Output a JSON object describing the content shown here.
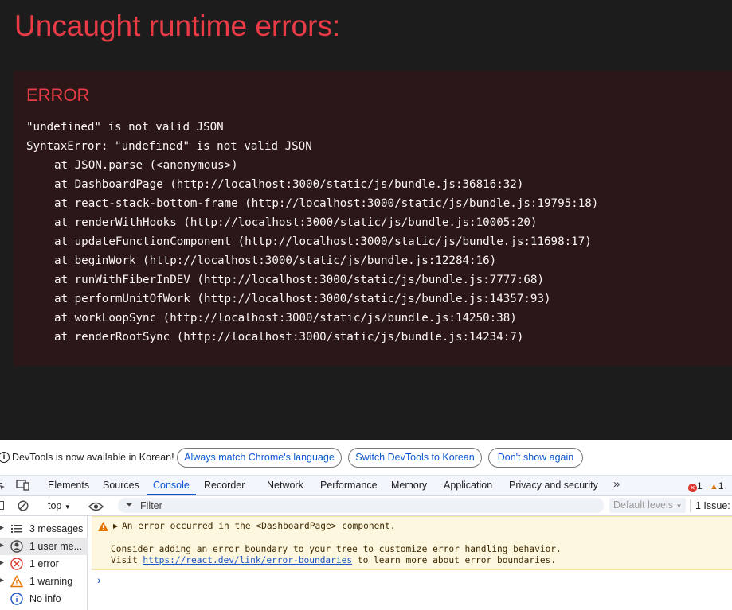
{
  "overlay": {
    "title": "Uncaught runtime errors:",
    "error_label": "ERROR",
    "message_lines": [
      "\"undefined\" is not valid JSON",
      "SyntaxError: \"undefined\" is not valid JSON"
    ],
    "stack": [
      "at JSON.parse (<anonymous>)",
      "at DashboardPage (http://localhost:3000/static/js/bundle.js:36816:32)",
      "at react-stack-bottom-frame (http://localhost:3000/static/js/bundle.js:19795:18)",
      "at renderWithHooks (http://localhost:3000/static/js/bundle.js:10005:20)",
      "at updateFunctionComponent (http://localhost:3000/static/js/bundle.js:11698:17)",
      "at beginWork (http://localhost:3000/static/js/bundle.js:12284:16)",
      "at runWithFiberInDEV (http://localhost:3000/static/js/bundle.js:7777:68)",
      "at performUnitOfWork (http://localhost:3000/static/js/bundle.js:14357:93)",
      "at workLoopSync (http://localhost:3000/static/js/bundle.js:14250:38)",
      "at renderRootSync (http://localhost:3000/static/js/bundle.js:14234:7)"
    ],
    "colors": {
      "title": "#e83b46",
      "box_bg": "#2b1718",
      "text": "#fbf5f4"
    }
  },
  "devtools": {
    "infobar": {
      "icon": "info-icon",
      "text": "DevTools is now available in Korean!",
      "buttons": [
        "Always match Chrome's language",
        "Switch DevTools to Korean",
        "Don't show again"
      ]
    },
    "tabs": [
      "Elements",
      "Sources",
      "Console",
      "Recorder",
      "Network",
      "Performance",
      "Memory",
      "Application",
      "Privacy and security"
    ],
    "active_tab": "Console",
    "more_tabs_icon": "chevron-double-right-icon",
    "error_count": "1",
    "warning_count": "1",
    "toolbar": {
      "context": "top",
      "filter_placeholder": "Filter",
      "levels": "Default levels",
      "issues": "1 Issue:"
    },
    "sidebar": [
      {
        "icon": "list-icon",
        "label": "3 messages"
      },
      {
        "icon": "user-icon",
        "label": "1 user me..."
      },
      {
        "icon": "error-icon",
        "label": "1 error"
      },
      {
        "icon": "warning-icon",
        "label": "1 warning"
      },
      {
        "icon": "info-icon",
        "label": "No info"
      }
    ],
    "console": {
      "message_line1": "An error occurred in the <DashboardPage> component.",
      "message_line2": "Consider adding an error boundary to your tree to customize error handling behavior.",
      "message_line3_prefix": "Visit ",
      "message_link": "https://react.dev/link/error-boundaries",
      "message_line3_suffix": " to learn more about error boundaries."
    }
  }
}
